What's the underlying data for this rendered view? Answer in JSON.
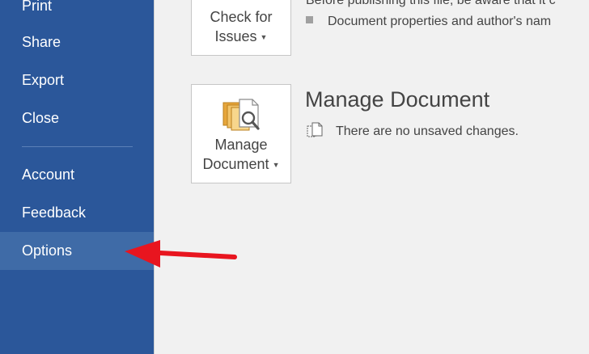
{
  "sidebar": {
    "items": [
      {
        "label": "Print"
      },
      {
        "label": "Share"
      },
      {
        "label": "Export"
      },
      {
        "label": "Close"
      },
      {
        "label": "Account"
      },
      {
        "label": "Feedback"
      },
      {
        "label": "Options"
      }
    ],
    "active_item": "Options"
  },
  "inspect": {
    "button_line1": "Check for",
    "button_line2": "Issues",
    "description": "Before publishing this file, be aware that it c",
    "bullet": "Document properties and author's nam"
  },
  "manage": {
    "button_line1": "Manage",
    "button_line2": "Document",
    "title": "Manage Document",
    "status": "There are no unsaved changes."
  },
  "colors": {
    "sidebar_bg": "#2b579a",
    "sidebar_active": "#3f6ba7",
    "annotation_arrow": "#e8151f"
  },
  "icons": {
    "caret": "chevron-down-icon",
    "manage_document": "documents-magnifier-icon",
    "versions": "document-versions-icon",
    "bullet": "square-bullet-icon"
  }
}
